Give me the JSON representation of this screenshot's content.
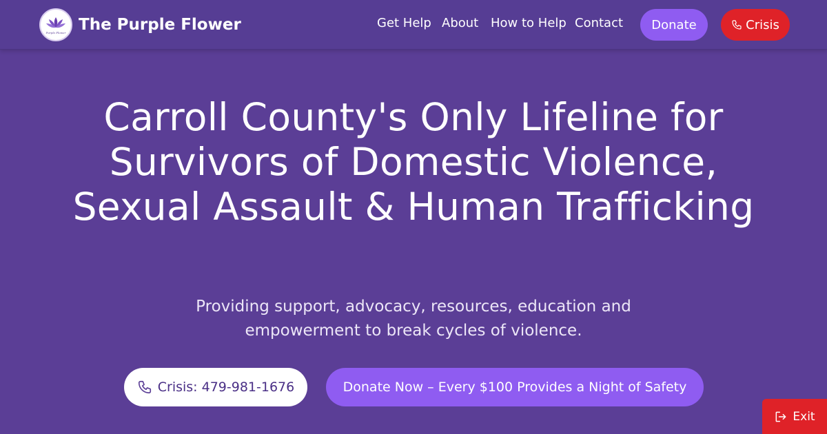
{
  "brand": {
    "name": "The Purple Flower",
    "logo_text": "Purple Flower"
  },
  "nav": {
    "links": [
      {
        "label": "Get Help"
      },
      {
        "label": "About"
      },
      {
        "label": "How to Help"
      },
      {
        "label": "Contact"
      }
    ],
    "donate_label": "Donate",
    "crisis_label": "Crisis"
  },
  "hero": {
    "headline": "Carroll County's Only Lifeline for Survivors of Domestic Violence, Sexual Assault & Human Trafficking",
    "subhead": "Providing support, advocacy, resources, education and empowerment to break cycles of violence.",
    "call_label": "Crisis: 479-981-1676",
    "donate_label": "Donate Now – Every $100 Provides a Night of Safety"
  },
  "exit": {
    "label": "Exit"
  },
  "colors": {
    "background": "#5b3e96",
    "navbar": "#563d94",
    "accent_purple": "#8f5cf1",
    "crisis_red": "#df2228",
    "white": "#ffffff"
  },
  "icons": {
    "logo": "purple-flower-logo",
    "crisis": "phone-icon",
    "call": "phone-icon",
    "exit": "exit-icon"
  }
}
